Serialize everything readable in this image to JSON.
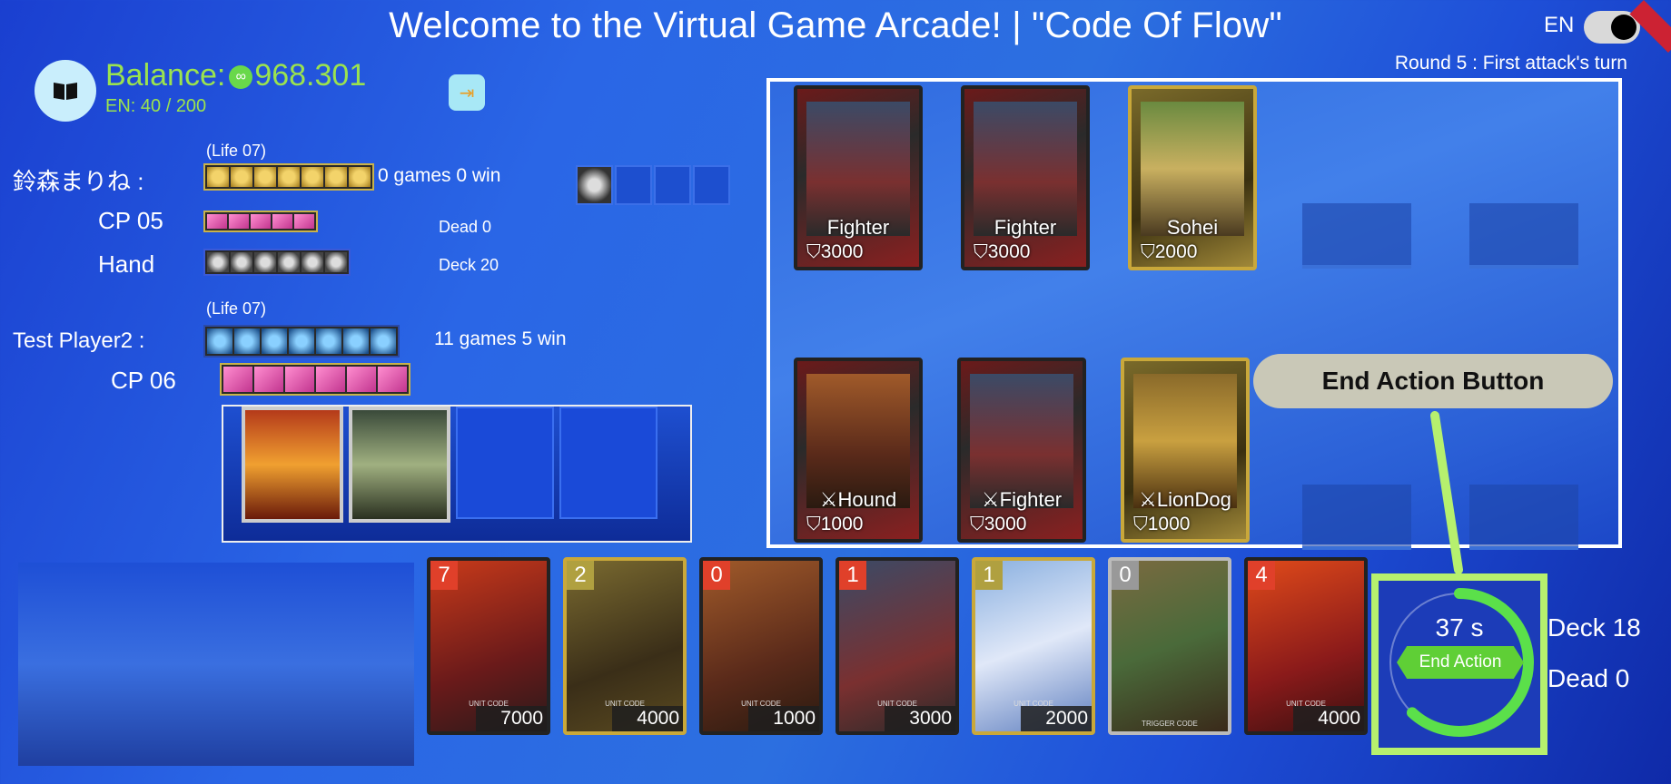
{
  "header": {
    "title": "Welcome to the Virtual Game Arcade! | \"Code Of Flow\"",
    "lang": "EN",
    "round": "Round 5 : First attack's turn"
  },
  "wallet": {
    "balance_label": "Balance:",
    "balance_value": "968.301",
    "energy": "EN:  40 / 200"
  },
  "player1": {
    "name": "鈴森まりね :",
    "life": "(Life 07)",
    "record": "0 games 0 win",
    "cp": "CP 05",
    "hand_label": "Hand",
    "dead": "Dead 0",
    "deck": "Deck 20"
  },
  "player2": {
    "name": "Test Player2 :",
    "life": "(Life 07)",
    "record": "11 games 5 win",
    "cp": "CP 06"
  },
  "board": {
    "top_row": [
      {
        "name": "Fighter",
        "power": "3000"
      },
      {
        "name": "Fighter",
        "power": "3000"
      },
      {
        "name": "Sohei",
        "power": "2000"
      }
    ],
    "bottom_row": [
      {
        "name": "Hound",
        "power": "1000"
      },
      {
        "name": "Fighter",
        "power": "3000"
      },
      {
        "name": "LionDog",
        "power": "1000"
      }
    ]
  },
  "hand_cards": [
    {
      "cost": "7",
      "value": "7000",
      "tag": "UNIT CODE"
    },
    {
      "cost": "2",
      "value": "4000",
      "tag": "UNIT CODE"
    },
    {
      "cost": "0",
      "value": "1000",
      "tag": "UNIT CODE"
    },
    {
      "cost": "1",
      "value": "3000",
      "tag": "UNIT CODE"
    },
    {
      "cost": "1",
      "value": "2000",
      "tag": "UNIT CODE"
    },
    {
      "cost": "0",
      "value": "",
      "tag": "TRIGGER CODE"
    },
    {
      "cost": "4",
      "value": "4000",
      "tag": "UNIT CODE"
    }
  ],
  "timer": {
    "seconds": "37 s",
    "button": "End Action",
    "remaining_fraction": 0.62
  },
  "callout": "End Action Button",
  "right_stats": {
    "deck": "Deck 18",
    "dead": "Dead 0"
  },
  "colors": {
    "accent_green": "#b6f06e",
    "balance_green": "#9be34e"
  }
}
